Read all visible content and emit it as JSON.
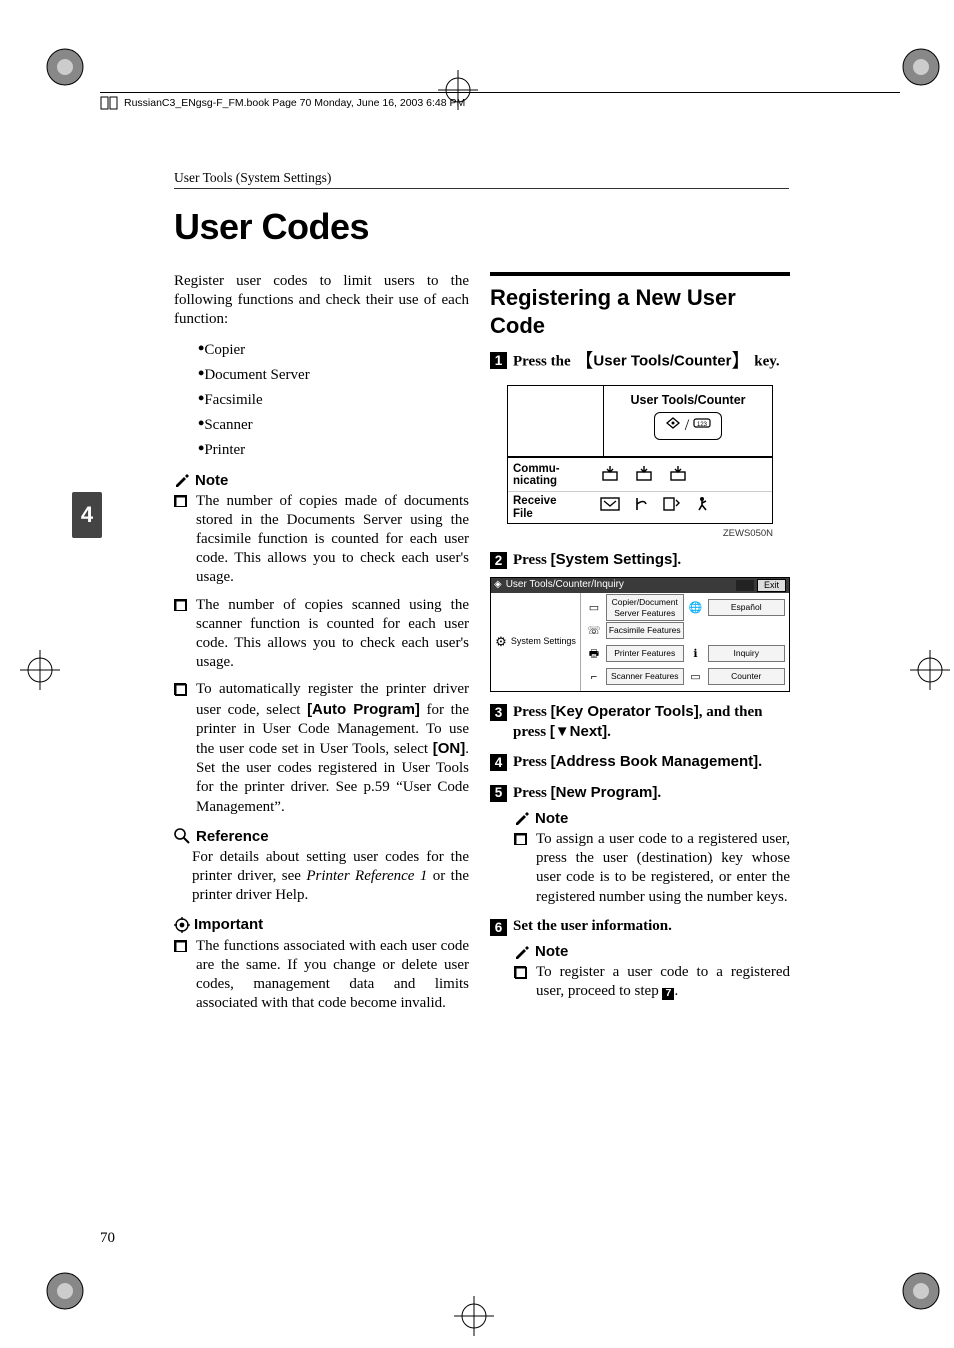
{
  "header": {
    "book_line": "RussianC3_ENgsg-F_FM.book  Page 70  Monday, June 16, 2003  6:48 PM",
    "running_head": "User Tools (System Settings)"
  },
  "title": "User Codes",
  "chapter_tab": "4",
  "page_number": "70",
  "col1": {
    "intro": "Register user codes to limit users to the following functions and check their use of each function:",
    "bullets": [
      "Copier",
      "Document Server",
      "Facsimile",
      "Scanner",
      "Printer"
    ],
    "note_label": "Note",
    "notes": [
      "The number of copies made of documents stored in the Documents Server using the facsimile function is counted for each user code. This allows you to check each user's usage.",
      "The number of copies scanned using the scanner function is counted for each user code. This allows you to check each user's usage.",
      "To automatically register the printer driver user code, select [Auto Program] for the printer in User Code Management. To use the user code set in User Tools, select [ON]. Set the user codes registered in User Tools for the printer driver. See p.59 “User Code Management”."
    ],
    "reference_label": "Reference",
    "reference_body_pre": "For details about setting user codes for the printer driver, see ",
    "reference_body_em": "Printer Reference 1",
    "reference_body_post": " or the printer driver Help.",
    "important_label": "Important",
    "important_items": [
      "The functions associated with each user code are the same. If you change or delete user codes, management data and limits associated with that code become invalid."
    ]
  },
  "col2": {
    "h2": "Registering a New User Code",
    "step1_pre": "Press the ",
    "step1_key": "User Tools/Counter",
    "step1_post": " key.",
    "panel": {
      "utc": "User Tools/Counter",
      "commu": "Commu-\nnicating",
      "receive": "Receive\nFile",
      "panel_id": "ZEWS050N"
    },
    "step2_pre": "Press ",
    "step2_key": "[System Settings]",
    "step2_post": ".",
    "screenshot": {
      "bar_title": "User Tools/Counter/Inquiry",
      "clock": "",
      "exit": "Exit",
      "left_label": "System Settings",
      "buttons": [
        "Copier/Document Server Features",
        "Español",
        "Facsimile Features",
        "",
        "Printer Features",
        "Inquiry",
        "Scanner Features",
        "Counter"
      ]
    },
    "step3_pre": "Press ",
    "step3_key1": "[Key Operator Tools]",
    "step3_mid": ", and then press ",
    "step3_key2": "[▼Next]",
    "step3_post": ".",
    "step4_pre": "Press ",
    "step4_key": "[Address Book Management]",
    "step4_post": ".",
    "step5_pre": "Press ",
    "step5_key": "[New Program]",
    "step5_post": ".",
    "note_label": "Note",
    "note5_items": [
      "To assign a user code to a registered user, press the user (destination) key whose user code is to be registered, or enter the registered number using the number keys."
    ],
    "step6_text": "Set the user information.",
    "note6_pre": "To register a user code to a registered user, proceed to step ",
    "note6_step": "7",
    "note6_post": "."
  }
}
